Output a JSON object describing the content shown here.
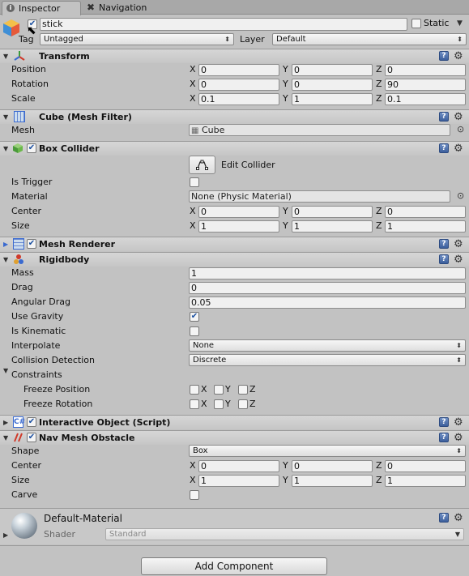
{
  "tabs": [
    {
      "label": "Inspector",
      "icon": "info-icon",
      "active": true
    },
    {
      "label": "Navigation",
      "icon": "navigation-icon",
      "active": false
    }
  ],
  "object": {
    "name": "stick",
    "active": true,
    "static_label": "Static",
    "static_checked": false,
    "tag_label": "Tag",
    "tag_value": "Untagged",
    "layer_label": "Layer",
    "layer_value": "Default"
  },
  "transform": {
    "title": "Transform",
    "position": {
      "label": "Position",
      "x": "0",
      "y": "0",
      "z": "0"
    },
    "rotation": {
      "label": "Rotation",
      "x": "0",
      "y": "0",
      "z": "90"
    },
    "scale": {
      "label": "Scale",
      "x": "0.1",
      "y": "1",
      "z": "0.1"
    }
  },
  "axes": {
    "x": "X",
    "y": "Y",
    "z": "Z"
  },
  "mesh_filter": {
    "title": "Cube (Mesh Filter)",
    "mesh_label": "Mesh",
    "mesh_value": "Cube"
  },
  "box_collider": {
    "title": "Box Collider",
    "enabled": true,
    "edit_label": "Edit Collider",
    "is_trigger_label": "Is Trigger",
    "is_trigger": false,
    "material_label": "Material",
    "material_value": "None (Physic Material)",
    "center": {
      "label": "Center",
      "x": "0",
      "y": "0",
      "z": "0"
    },
    "size": {
      "label": "Size",
      "x": "1",
      "y": "1",
      "z": "1"
    }
  },
  "mesh_renderer": {
    "title": "Mesh Renderer",
    "enabled": true
  },
  "rigidbody": {
    "title": "Rigidbody",
    "mass_label": "Mass",
    "mass": "1",
    "drag_label": "Drag",
    "drag": "0",
    "angular_drag_label": "Angular Drag",
    "angular_drag": "0.05",
    "use_gravity_label": "Use Gravity",
    "use_gravity": true,
    "is_kinematic_label": "Is Kinematic",
    "is_kinematic": false,
    "interpolate_label": "Interpolate",
    "interpolate": "None",
    "collision_label": "Collision Detection",
    "collision": "Discrete",
    "constraints_label": "Constraints",
    "freeze_position_label": "Freeze Position",
    "freeze_rotation_label": "Freeze Rotation"
  },
  "interactive_object": {
    "title": "Interactive Object (Script)",
    "enabled": true
  },
  "nav_mesh_obstacle": {
    "title": "Nav Mesh Obstacle",
    "enabled": true,
    "shape_label": "Shape",
    "shape": "Box",
    "center": {
      "label": "Center",
      "x": "0",
      "y": "0",
      "z": "0"
    },
    "size": {
      "label": "Size",
      "x": "1",
      "y": "1",
      "z": "1"
    },
    "carve_label": "Carve",
    "carve": false
  },
  "material": {
    "name": "Default-Material",
    "shader_label": "Shader",
    "shader_value": "Standard"
  },
  "add_component_label": "Add Component",
  "colors": {
    "background": "#c2c2c2",
    "help_icon": "#4a6ca8",
    "checkbox_tick": "#1a4fa0"
  }
}
